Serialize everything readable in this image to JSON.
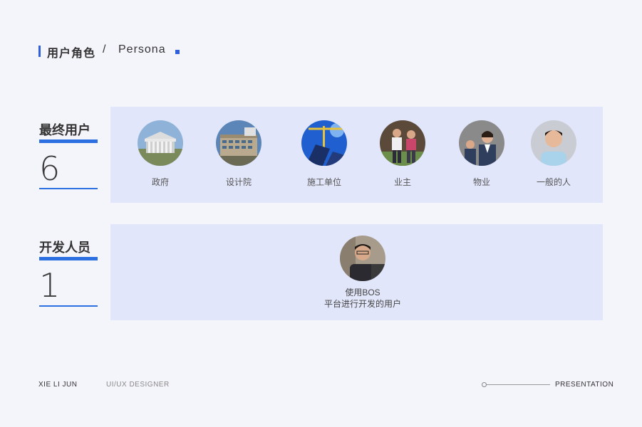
{
  "header": {
    "title_cn": "用户角色",
    "separator": "/",
    "title_en": "Persona"
  },
  "end_users": {
    "label": "最终用户",
    "count": "6",
    "personas": [
      {
        "label": "政府",
        "icon": "government-building-photo"
      },
      {
        "label": "设计院",
        "icon": "design-institute-building-photo"
      },
      {
        "label": "施工单位",
        "icon": "construction-crane-photo"
      },
      {
        "label": "业主",
        "icon": "owners-photo"
      },
      {
        "label": "物业",
        "icon": "property-staff-photo"
      },
      {
        "label": "一般的人",
        "icon": "ordinary-person-photo"
      }
    ]
  },
  "developers": {
    "label": "开发人员",
    "count": "1",
    "persona": {
      "line1": "使用BOS",
      "line2": "平台进行开发的用户",
      "icon": "developer-photo"
    }
  },
  "footer": {
    "name": "XIE LI JUN",
    "role": "UI/UX DESIGNER",
    "right": "PRESENTATION"
  },
  "colors": {
    "accent": "#2b6fe0",
    "panel": "#e2e6fa",
    "background": "#f4f5fb"
  }
}
